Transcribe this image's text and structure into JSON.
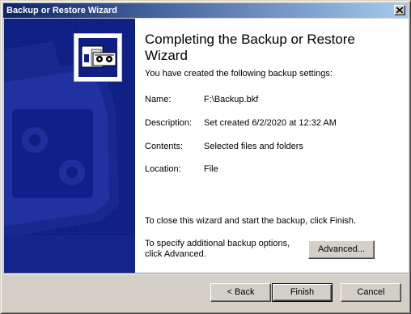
{
  "window": {
    "title": "Backup or Restore Wizard",
    "close_glyph": "✕"
  },
  "banner": {
    "background_color": "#0e1e82",
    "logo_icon": "backup-tapes-icon"
  },
  "content": {
    "heading": "Completing the Backup or Restore Wizard",
    "intro": "You have created the following backup settings:",
    "settings": [
      {
        "label": "Name:",
        "value": "F:\\Backup.bkf"
      },
      {
        "label": "Description:",
        "value": "Set created 6/2/2020 at 12:32 AM"
      },
      {
        "label": "Contents:",
        "value": "Selected files and folders"
      },
      {
        "label": "Location:",
        "value": "File"
      }
    ],
    "close_message": "To close this wizard and start the backup, click Finish.",
    "advanced_message": "To specify additional backup options, click Advanced.",
    "advanced_button": "Advanced..."
  },
  "footer": {
    "back_button": "< Back",
    "finish_button": "Finish",
    "cancel_button": "Cancel"
  }
}
